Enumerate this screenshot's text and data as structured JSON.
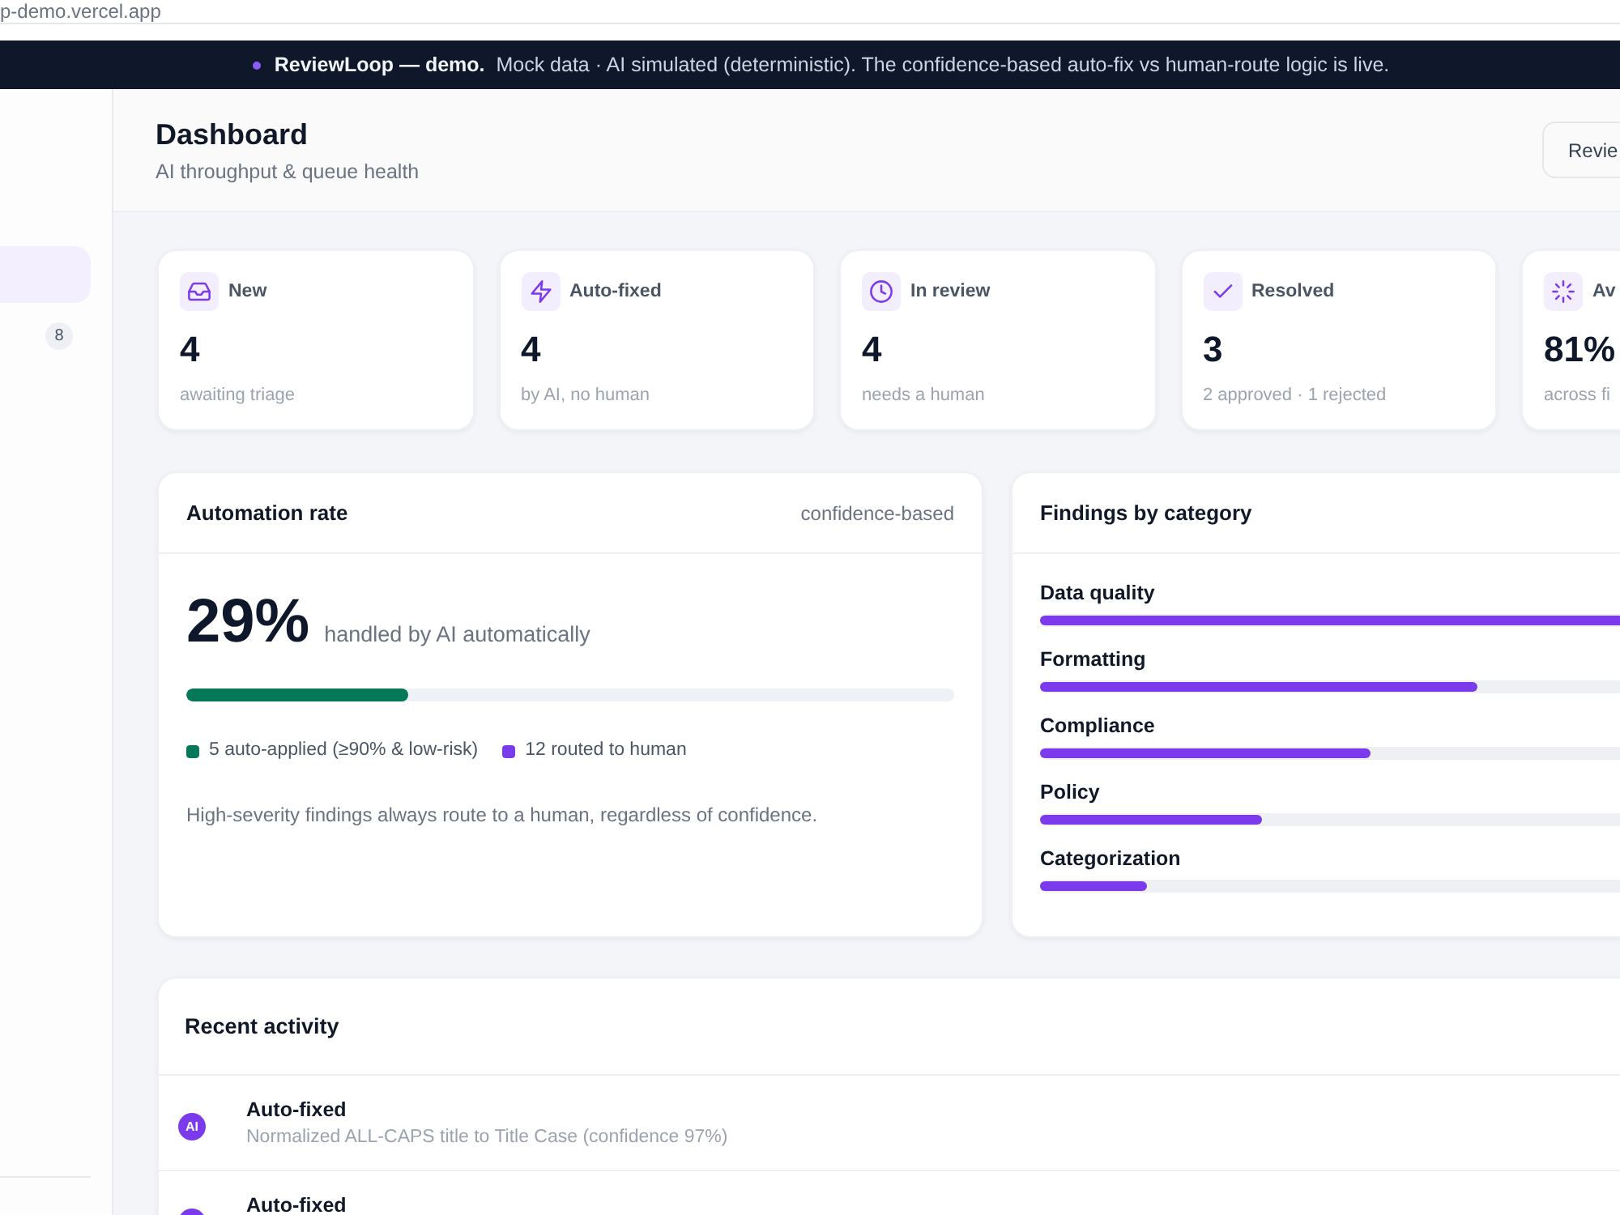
{
  "browser": {
    "url": "p-demo.vercel.app"
  },
  "banner": {
    "text": "**ReviewLoop — demo.**  Mock data · AI simulated (deterministic). The confidence-based auto-fix vs human-route logic is live."
  },
  "sidebar": {
    "items": [
      {
        "selected": true
      },
      {
        "selected": false,
        "badge": "8"
      }
    ]
  },
  "header": {
    "title": "Dashboard",
    "subtitle": "AI throughput & queue health",
    "button": "Revie"
  },
  "stats": [
    {
      "label": "New",
      "value": "4",
      "note": "awaiting triage"
    },
    {
      "label": "Auto-fixed",
      "value": "4",
      "note": "by AI, no human"
    },
    {
      "label": "In review",
      "value": "4",
      "note": "needs a human"
    },
    {
      "label": "Resolved",
      "value": "3",
      "note": "2 approved · 1 rejected"
    },
    {
      "label": "Av",
      "value": "81%",
      "note": "across fi"
    }
  ],
  "automation": {
    "title": "Automation rate",
    "tag": "confidence-based",
    "value": "29%",
    "caption": "handled by AI automatically",
    "level": 0.29,
    "legend": [
      {
        "label": "5 auto-applied (≥90% & low-risk)",
        "color": "#047857"
      },
      {
        "label": "12 routed to human",
        "color": "#7c3aed"
      }
    ],
    "note": "High-severity findings always route to a human, regardless of confidence."
  },
  "findings": {
    "title": "Findings by category",
    "categories": [
      {
        "name": "Data quality",
        "level": 1
      },
      {
        "name": "Formatting",
        "level": 0.57
      },
      {
        "name": "Compliance",
        "level": 0.43
      },
      {
        "name": "Policy",
        "level": 0.29
      },
      {
        "name": "Categorization",
        "level": 0.14
      }
    ]
  },
  "activity": {
    "title": "Recent activity",
    "items": [
      {
        "badge": "AI",
        "title": "Auto-fixed",
        "detail": "Normalized ALL-CAPS title to Title Case (confidence 97%)"
      },
      {
        "title": "Auto-fixed"
      }
    ]
  }
}
